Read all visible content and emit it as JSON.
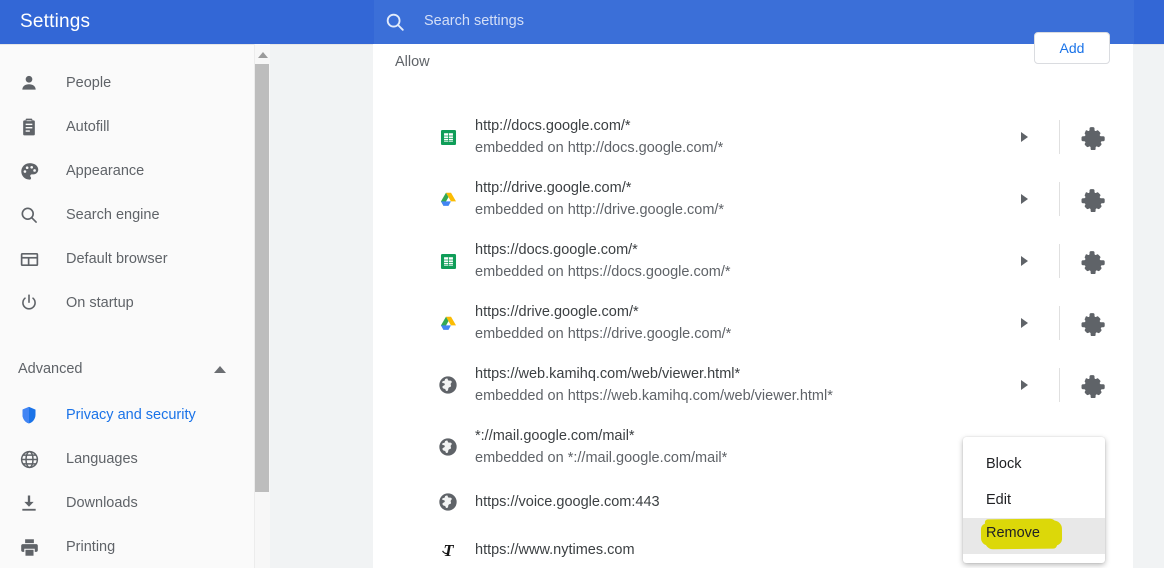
{
  "header": {
    "title": "Settings",
    "search_placeholder": "Search settings",
    "search_icon": "search-icon",
    "bar_color": "#3367d6",
    "search_field_color": "#3b6fd8"
  },
  "sidebar": {
    "items": [
      {
        "label": "People",
        "icon": "person-icon",
        "active": false
      },
      {
        "label": "Autofill",
        "icon": "clipboard-icon",
        "active": false
      },
      {
        "label": "Appearance",
        "icon": "palette-icon",
        "active": false
      },
      {
        "label": "Search engine",
        "icon": "search-icon",
        "active": false
      },
      {
        "label": "Default browser",
        "icon": "browser-window-icon",
        "active": false
      },
      {
        "label": "On startup",
        "icon": "power-icon",
        "active": false
      }
    ],
    "section": {
      "label": "Advanced",
      "chevron_icon": "chevron-up-icon",
      "expanded": true,
      "items": [
        {
          "label": "Privacy and security",
          "icon": "shield-icon",
          "active": true
        },
        {
          "label": "Languages",
          "icon": "globe-icon",
          "active": false
        },
        {
          "label": "Downloads",
          "icon": "download-icon",
          "active": false
        },
        {
          "label": "Printing",
          "icon": "printer-icon",
          "active": false
        }
      ]
    },
    "active_color": "#1a73e8",
    "scrollbar": {
      "up_arrow_icon": "scroll-up-arrow-icon"
    }
  },
  "main": {
    "group_label": "Allow",
    "add_button_label": "Add",
    "add_button_color": "#1a73e8",
    "rows": [
      {
        "title": "http://docs.google.com/*",
        "subtitle": "embedded on http://docs.google.com/*",
        "icon": "google-sheets-icon",
        "has_chevron": true,
        "extension_icon": "puzzle-piece-icon"
      },
      {
        "title": "http://drive.google.com/*",
        "subtitle": "embedded on http://drive.google.com/*",
        "icon": "google-drive-icon",
        "has_chevron": true,
        "extension_icon": "puzzle-piece-icon"
      },
      {
        "title": "https://docs.google.com/*",
        "subtitle": "embedded on https://docs.google.com/*",
        "icon": "google-sheets-icon",
        "has_chevron": true,
        "extension_icon": "puzzle-piece-icon"
      },
      {
        "title": "https://drive.google.com/*",
        "subtitle": "embedded on https://drive.google.com/*",
        "icon": "google-drive-icon",
        "has_chevron": true,
        "extension_icon": "puzzle-piece-icon"
      },
      {
        "title": "https://web.kamihq.com/web/viewer.html*",
        "subtitle": "embedded on https://web.kamihq.com/web/viewer.html*",
        "icon": "globe-icon",
        "has_chevron": true,
        "extension_icon": "puzzle-piece-icon"
      },
      {
        "title": "*://mail.google.com/mail*",
        "subtitle": "embedded on *://mail.google.com/mail*",
        "icon": "globe-icon",
        "has_chevron": false,
        "extension_icon": "puzzle-piece-icon"
      },
      {
        "title": "https://voice.google.com:443",
        "subtitle": "",
        "icon": "globe-icon",
        "has_chevron": false,
        "extension_icon": ""
      },
      {
        "title": "https://www.nytimes.com",
        "subtitle": "",
        "icon": "nytimes-icon",
        "has_chevron": false,
        "extension_icon": ""
      }
    ]
  },
  "context_menu": {
    "items": [
      {
        "label": "Block",
        "hovered": false
      },
      {
        "label": "Edit",
        "hovered": false
      },
      {
        "label": "Remove",
        "hovered": true
      }
    ]
  },
  "annotation": {
    "highlight_label": "Remove",
    "highlight_color": "#f2ee09"
  }
}
